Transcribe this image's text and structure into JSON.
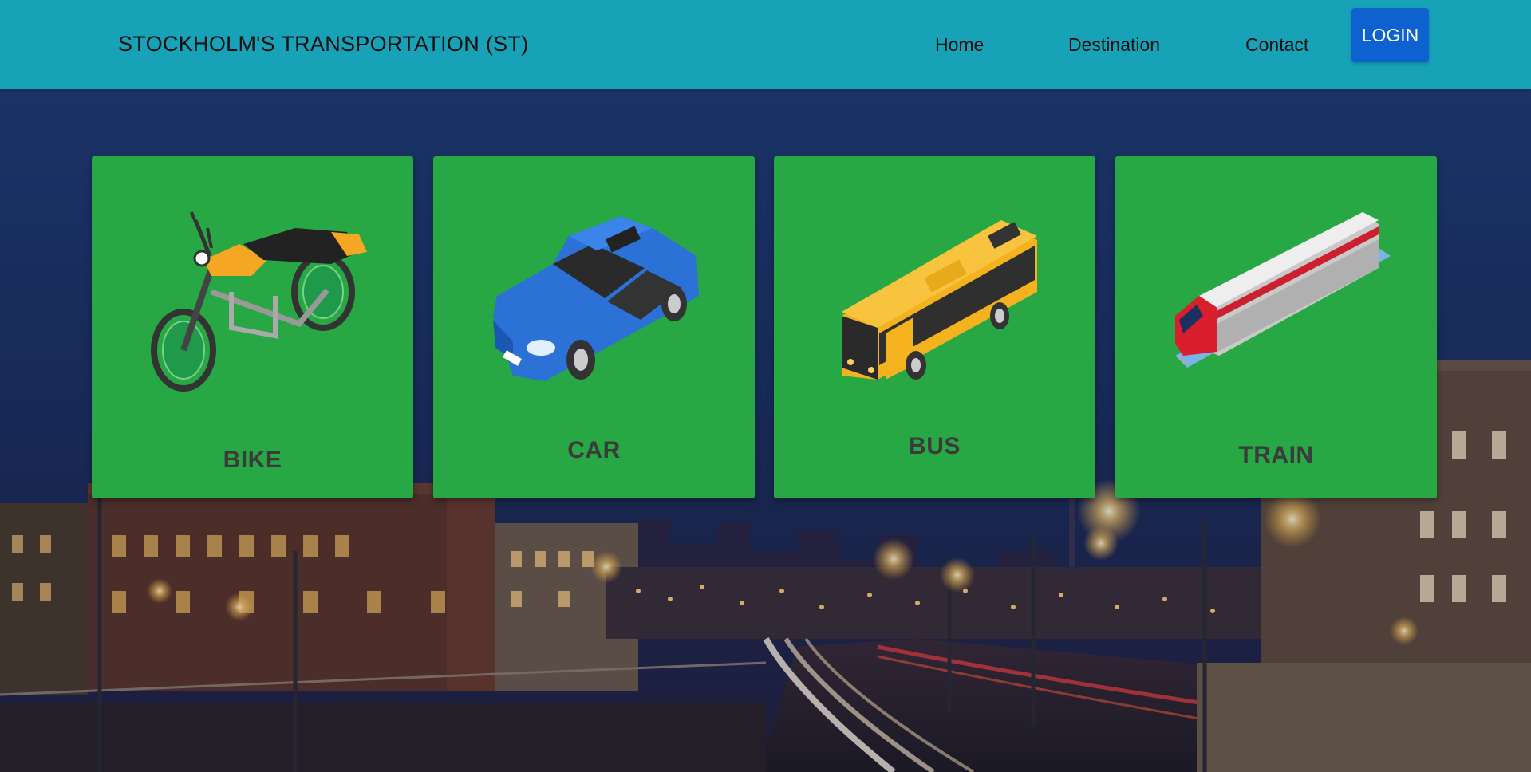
{
  "navbar": {
    "brand": "STOCKHOLM'S TRANSPORTATION (ST)",
    "links": [
      "Home",
      "Destination",
      "Contact"
    ],
    "login_label": "LOGIN",
    "background": "#17a2b8",
    "login_color": "#0d62cf"
  },
  "cards": [
    {
      "label": "BIKE",
      "icon": "motorcycle-icon"
    },
    {
      "label": "CAR",
      "icon": "car-icon"
    },
    {
      "label": "BUS",
      "icon": "bus-icon"
    },
    {
      "label": "TRAIN",
      "icon": "train-icon"
    }
  ],
  "colors": {
    "card_background": "#28a745",
    "hero_sky": "#1c2d55"
  }
}
